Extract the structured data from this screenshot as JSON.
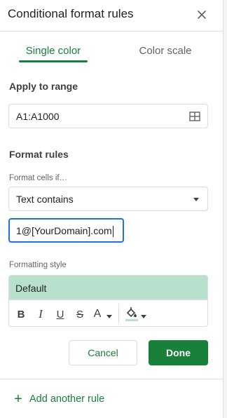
{
  "panel": {
    "title": "Conditional format rules"
  },
  "tabs": [
    {
      "label": "Single color",
      "active": true
    },
    {
      "label": "Color scale",
      "active": false
    }
  ],
  "apply_range": {
    "heading": "Apply to range",
    "value": "A1:A1000"
  },
  "format_rules": {
    "heading": "Format rules",
    "condition_label": "Format cells if…",
    "condition_value": "Text contains",
    "value_input": "1@[YourDomain].com"
  },
  "formatting_style": {
    "label": "Formatting style",
    "preview_text": "Default",
    "preview_color": "#b7e1cd",
    "tools": {
      "bold": "B",
      "italic": "I",
      "underline": "U",
      "strike": "S",
      "text_color": "A"
    }
  },
  "actions": {
    "cancel": "Cancel",
    "done": "Done"
  },
  "add_rule": {
    "plus": "+",
    "label": "Add another rule"
  },
  "colors": {
    "accent": "#188038",
    "focus": "#1a73e8"
  }
}
